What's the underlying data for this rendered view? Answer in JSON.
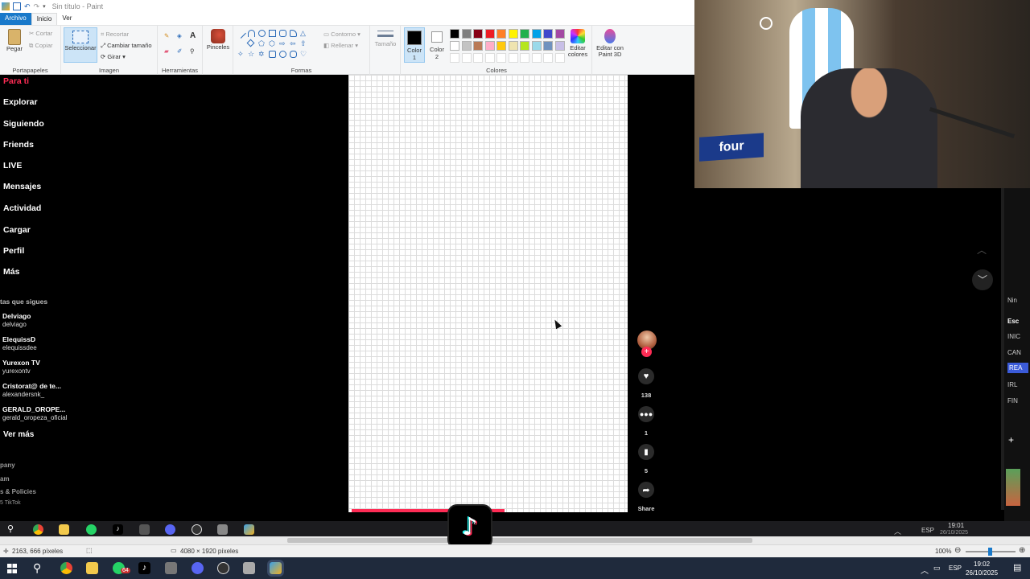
{
  "paint": {
    "window_title": "Sin título - Paint",
    "menu_tabs": [
      "Archivo",
      "Inicio",
      "Ver"
    ],
    "clipboard": {
      "paste": "Pegar",
      "cut": "Cortar",
      "copy": "Copiar",
      "label": "Portapapeles"
    },
    "image": {
      "select": "Seleccionar",
      "crop": "Recortar",
      "resize": "Cambiar tamaño",
      "rotate": "Girar",
      "label": "Imagen"
    },
    "tools": {
      "label": "Herramientas"
    },
    "brushes": {
      "label": "Pinceles"
    },
    "shapes": {
      "outline": "Contorno",
      "fill": "Rellenar",
      "label": "Formas"
    },
    "size": {
      "label": "Tamaño"
    },
    "color1": "Color 1",
    "color2": "Color 2",
    "colors_label": "Colores",
    "edit_colors": "Editar colores",
    "edit_3d": "Editar con Paint 3D",
    "palette": [
      "#000000",
      "#7f7f7f",
      "#880015",
      "#ed1c24",
      "#ff7f27",
      "#fff200",
      "#22b14c",
      "#00a2e8",
      "#3f48cc",
      "#a349a4",
      "#ffffff",
      "#c3c3c3",
      "#b97a57",
      "#ffaec9",
      "#ffc90e",
      "#efe4b0",
      "#b5e61d",
      "#99d9ea",
      "#7092be",
      "#c8bfe7"
    ],
    "status": {
      "cursor_pos": "2163, 666 píxeles",
      "canvas_size": "4080 × 1920 píxeles",
      "zoom": "100%"
    }
  },
  "tiktok": {
    "nav": [
      "Para ti",
      "Explorar",
      "Siguiendo",
      "Friends",
      "LIVE",
      "Mensajes",
      "Actividad",
      "Cargar",
      "Perfil",
      "Más"
    ],
    "following_header": "tas que sigues",
    "following": [
      {
        "name": "Delviago",
        "handle": "delviago"
      },
      {
        "name": "ElequissD",
        "handle": "elequissdee"
      },
      {
        "name": "Yurexon TV",
        "handle": "yurexontv"
      },
      {
        "name": "Cristorat@ de te...",
        "handle": "alexandersnk_"
      },
      {
        "name": "GERALD_OROPE...",
        "handle": "gerald_oropeza_oficial"
      }
    ],
    "see_more": "Ver más",
    "footer": [
      "pany",
      "am",
      "s & Policies",
      "5 TikTok"
    ],
    "likes": "138",
    "comments": "1",
    "saves": "5",
    "share": "Share"
  },
  "right_panel": {
    "tags": [
      "Nin",
      "Esc",
      "INIC",
      "CAN",
      "REA",
      "IRL",
      "FIN"
    ]
  },
  "inner_clock": {
    "time": "19:01",
    "date": "26/10/2025",
    "lang": "ESP"
  },
  "taskbar": {
    "time": "19:02",
    "date": "26/10/2025",
    "lang": "ESP",
    "badge": "64"
  },
  "colors": {
    "accent": "#1979ca",
    "tiktok_red": "#fe2c55",
    "taskbar": "#1f2a3c"
  }
}
